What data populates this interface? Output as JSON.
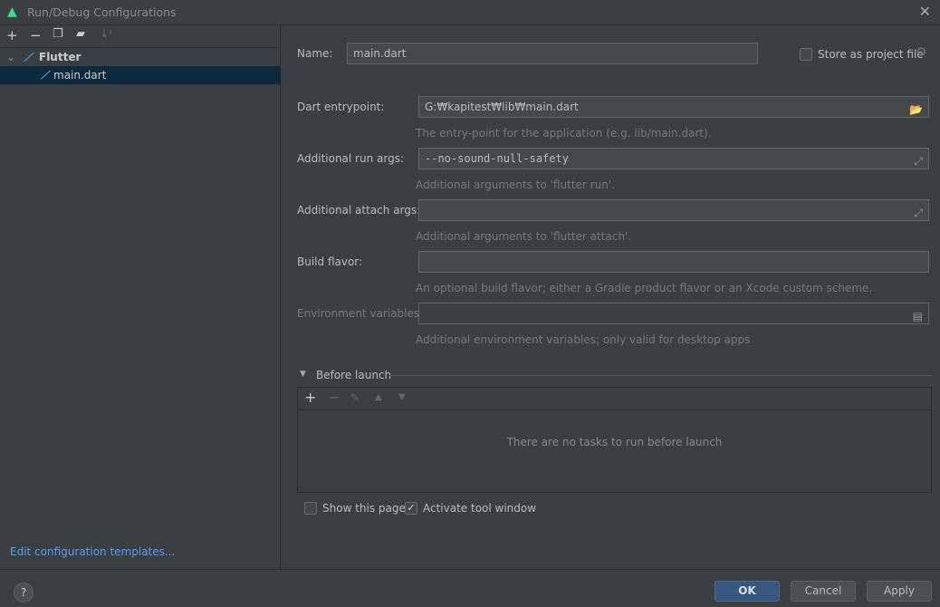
{
  "window": {
    "title": "Run/Debug Configurations"
  },
  "left": {
    "tree": {
      "group": "Flutter",
      "item": "main.dart"
    },
    "edit_templates_link": "Edit configuration templates..."
  },
  "form": {
    "name_label": "Name:",
    "name_value": "main.dart",
    "store_label": "Store as project file",
    "entrypoint_label": "Dart entrypoint:",
    "entrypoint_value": "G:₩kapitest₩lib₩main.dart",
    "entrypoint_hint": "The entry-point for the application (e.g. lib/main.dart).",
    "run_args_label": "Additional run args:",
    "run_args_value": "--no-sound-null-safety",
    "run_args_hint": "Additional arguments to 'flutter run'.",
    "attach_args_label": "Additional attach args:",
    "attach_args_value": "",
    "attach_args_hint": "Additional arguments to 'flutter attach'.",
    "flavor_label": "Build flavor:",
    "flavor_value": "",
    "flavor_hint": "An optional build flavor; either a Gradle product flavor or an Xcode custom scheme.",
    "env_label": "Environment variables:",
    "env_value": "",
    "env_hint": "Additional environment variables; only valid for desktop apps"
  },
  "before_launch": {
    "title": "Before launch",
    "empty_text": "There are no tasks to run before launch",
    "show_page_label": "Show this page",
    "show_page_checked": false,
    "activate_label": "Activate tool window",
    "activate_checked": true
  },
  "buttons": {
    "ok": "OK",
    "cancel": "Cancel",
    "apply": "Apply",
    "help": "?"
  },
  "colors": {
    "accent": "#365880",
    "selection": "#0d293e",
    "link": "#589df6",
    "background": "#3c3f41"
  }
}
